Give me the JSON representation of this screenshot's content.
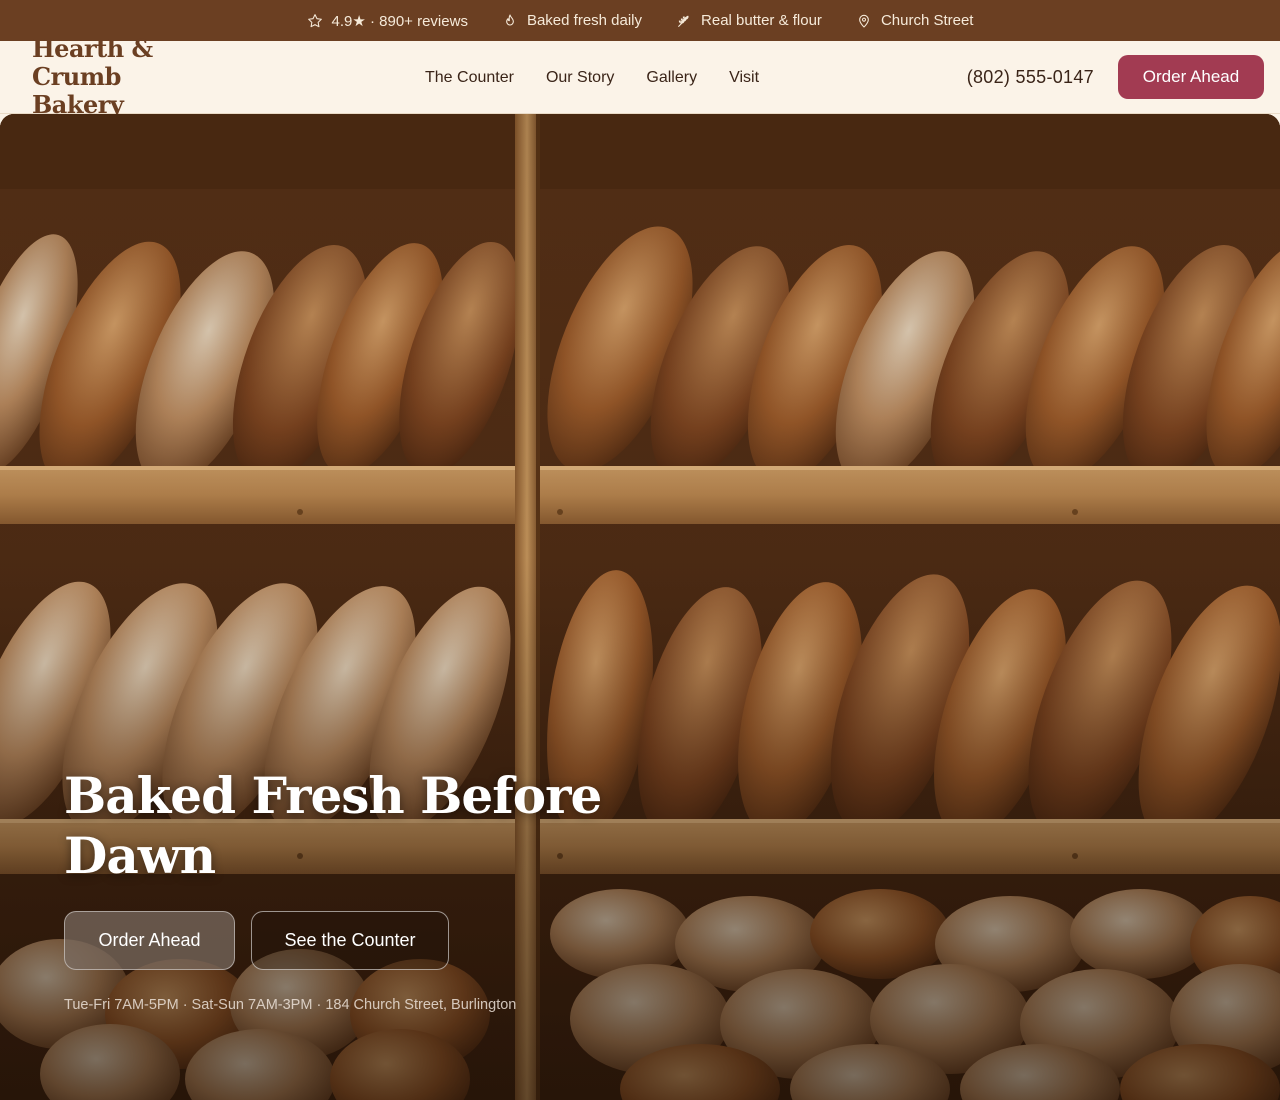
{
  "topbar": {
    "items": [
      {
        "icon": "star-icon",
        "text": "4.9★ · 890+ reviews"
      },
      {
        "icon": "flame-icon",
        "text": "Baked fresh daily"
      },
      {
        "icon": "wheat-icon",
        "text": "Real butter & flour"
      },
      {
        "icon": "map-pin-icon",
        "text": "Church Street"
      }
    ]
  },
  "header": {
    "logo_line1": "Hearth & Crumb",
    "logo_line2": "Bakery",
    "nav": [
      "The Counter",
      "Our Story",
      "Gallery",
      "Visit"
    ],
    "phone": "(802) 555-0147",
    "order_label": "Order Ahead"
  },
  "hero": {
    "title_line1": "Baked Fresh Before",
    "title_line2": "Dawn",
    "primary_label": "Order Ahead",
    "secondary_label": "See the Counter",
    "info": "Tue-Fri 7AM-5PM · Sat-Sun 7AM-3PM · 184 Church Street, Burlington"
  },
  "colors": {
    "topbar_bg": "#6b3f22",
    "header_bg": "#fbf3e8",
    "accent": "#a23b52",
    "brand_text": "#6b3f22"
  }
}
